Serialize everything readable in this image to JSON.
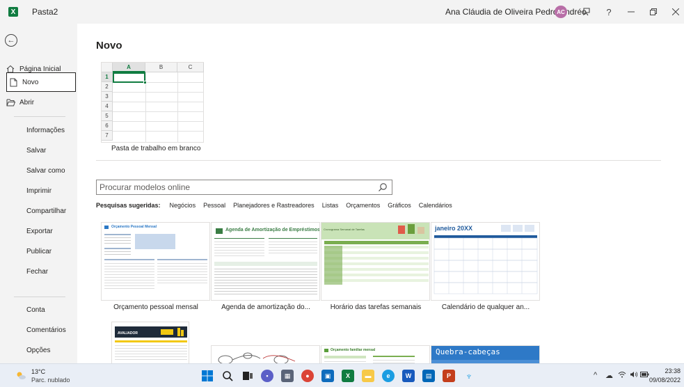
{
  "titlebar": {
    "app_icon": "excel-icon",
    "doc_title": "Pasta2",
    "user_name": "Ana Cláudia de Oliveira Pedro Andréo",
    "avatar_initials": "AC",
    "icons": [
      "feedback-icon",
      "help-icon",
      "minimize-icon",
      "restore-icon",
      "close-icon"
    ]
  },
  "sidebar": {
    "back_icon": "back-arrow-icon",
    "items": [
      {
        "label": "Página Inicial",
        "icon": "home-icon"
      },
      {
        "label": "Novo",
        "icon": "new-document-icon",
        "selected": true
      },
      {
        "label": "Abrir",
        "icon": "folder-open-icon"
      },
      {
        "label": "Informações"
      },
      {
        "label": "Salvar"
      },
      {
        "label": "Salvar como"
      },
      {
        "label": "Imprimir"
      },
      {
        "label": "Compartilhar"
      },
      {
        "label": "Exportar"
      },
      {
        "label": "Publicar"
      },
      {
        "label": "Fechar"
      },
      {
        "label": "Conta"
      },
      {
        "label": "Comentários"
      },
      {
        "label": "Opções"
      }
    ]
  },
  "main": {
    "title": "Novo",
    "blank": {
      "label": "Pasta de trabalho em branco",
      "columns": [
        "A",
        "B",
        "C"
      ],
      "rows": [
        "1",
        "2",
        "3",
        "4",
        "5",
        "6",
        "7"
      ]
    },
    "search": {
      "placeholder": "Procurar modelos online"
    },
    "suggestions": {
      "lead": "Pesquisas sugeridas:",
      "links": [
        "Negócios",
        "Pessoal",
        "Planejadores e Rastreadores",
        "Listas",
        "Orçamentos",
        "Gráficos",
        "Calendários"
      ]
    },
    "templates": [
      {
        "label": "Orçamento pessoal mensal",
        "heading": "Orçamento Pessoal Mensal"
      },
      {
        "label": "Agenda de amortização do...",
        "heading": "Agenda de Amortização de Empréstimos"
      },
      {
        "label": "Horário das tarefas semanais",
        "heading": "Cronograma Semanal de Tarefas"
      },
      {
        "label": "Calendário de qualquer an...",
        "heading": "janeiro 20XX"
      },
      {
        "label": "",
        "heading": "AVALIADOR"
      },
      {
        "label": "",
        "heading": ""
      },
      {
        "label": "",
        "heading": "Orçamento familiar mensal"
      },
      {
        "label": "",
        "heading": "Quebra-cabeças"
      }
    ],
    "colors": {
      "excel_green": "#107c41",
      "accent_blue": "#1f5a9c"
    }
  },
  "taskbar": {
    "weather": {
      "temp": "13°C",
      "desc": "Parc. nublado"
    },
    "apps": [
      "windows-start-icon",
      "search-icon",
      "task-view-icon",
      "chat-icon",
      "calculator-icon",
      "chrome-icon",
      "photos-icon",
      "excel-icon",
      "file-explorer-icon",
      "edge-icon",
      "word-icon",
      "store-icon",
      "powerpoint-icon",
      "app-icon"
    ],
    "clock": {
      "time": "23:38",
      "date": "09/08/2022"
    }
  }
}
